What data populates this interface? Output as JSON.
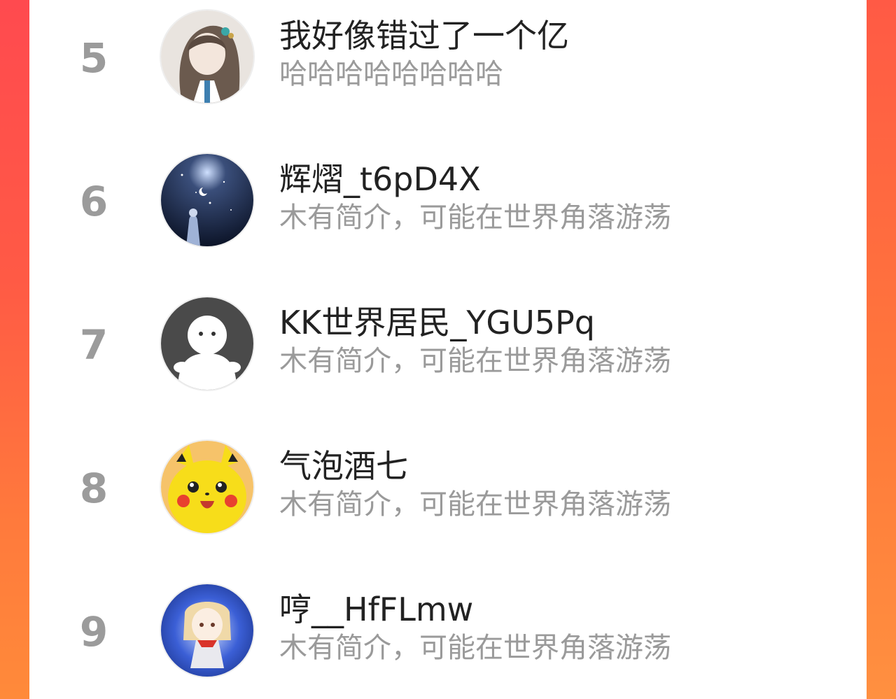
{
  "list": {
    "items": [
      {
        "rank": "5",
        "name": "我好像错过了一个亿",
        "desc": "哈哈哈哈哈哈哈哈",
        "avatar_icon": "anime-character-avatar"
      },
      {
        "rank": "6",
        "name": "辉熠_t6pD4X",
        "desc": "木有简介，可能在世界角落游荡",
        "avatar_icon": "night-sky-avatar"
      },
      {
        "rank": "7",
        "name": "KK世界居民_YGU5Pq",
        "desc": "木有简介，可能在世界角落游荡",
        "avatar_icon": "default-user-avatar"
      },
      {
        "rank": "8",
        "name": "气泡酒七",
        "desc": "木有简介，可能在世界角落游荡",
        "avatar_icon": "pikachu-avatar"
      },
      {
        "rank": "9",
        "name": "哼__HfFLmw",
        "desc": "木有简介，可能在世界角落游荡",
        "avatar_icon": "anime-girl-blue-avatar"
      }
    ]
  },
  "colors": {
    "rank": "#9b9b9b",
    "name": "#222222",
    "desc": "#9a9a9a",
    "background_accent": "#ff5a45"
  }
}
